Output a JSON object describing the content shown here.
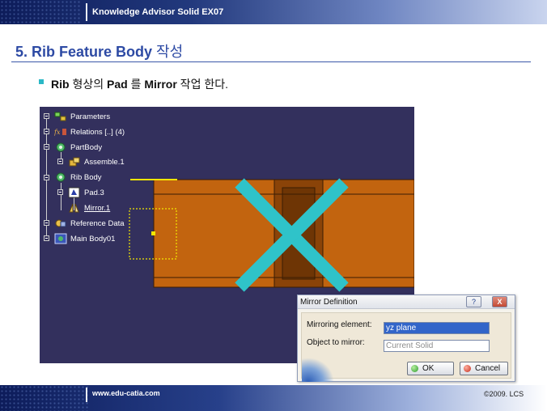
{
  "header": {
    "course_title": "Knowledge Advisor Solid EX07"
  },
  "section": {
    "number_title": "5. Rib Feature Body",
    "title_suffix": "작성"
  },
  "bullet": {
    "part1": "Rib",
    "part2": " 형상의 ",
    "part3": "Pad",
    "part4": " 를 ",
    "part5": "Mirror",
    "part6": " 작업 한다."
  },
  "spec_tree": {
    "items": [
      {
        "label": "Parameters",
        "icon": "parameters-icon"
      },
      {
        "label": "Relations [..] (4)",
        "icon": "relations-icon"
      },
      {
        "label": "PartBody",
        "icon": "partbody-icon"
      },
      {
        "label": "Assemble.1",
        "icon": "assemble-icon"
      },
      {
        "label": "Rib Body",
        "icon": "body-icon"
      },
      {
        "label": "Pad.3",
        "icon": "pad-icon"
      },
      {
        "label": "Mirror.1",
        "icon": "mirror-icon"
      },
      {
        "label": "Reference Data",
        "icon": "reference-data-icon"
      },
      {
        "label": "Main Body01",
        "icon": "main-body-icon"
      }
    ]
  },
  "colors": {
    "viewport_bg": "#33305d",
    "rib_fill": "#c2640f",
    "rib_dark": "#7a3b06",
    "cross": "#2fc3c9",
    "highlight": "#f3e600"
  },
  "dialog": {
    "title": "Mirror Definition",
    "help_glyph": "?",
    "close_glyph": "X",
    "mirroring_label": "Mirroring element:",
    "mirroring_value": "yz plane",
    "object_label": "Object to mirror:",
    "object_value": "Current Solid",
    "ok_label": "OK",
    "cancel_label": "Cancel"
  },
  "footer": {
    "url": "www.edu-catia.com",
    "copyright": "©2009. LCS"
  }
}
